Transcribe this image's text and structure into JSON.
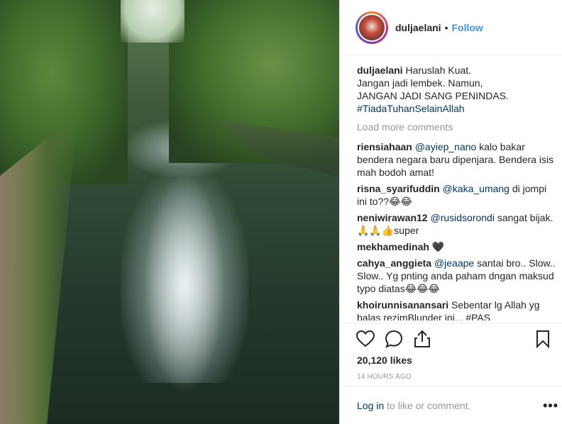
{
  "post": {
    "username": "duljaelani",
    "separator": "•",
    "follow_label": "Follow",
    "caption_lines": [
      "Haruslah Kuat.",
      "Jangan jadi lembek. Namun,",
      "JANGAN JADI SANG PENINDAS."
    ],
    "caption_hashtag": "#TiadaTuhanSelainAllah",
    "load_more_label": "Load more comments",
    "comments": [
      {
        "user": "riensiahaan",
        "mention": "@ayiep_nano",
        "text": "kalo bakar bendera negara baru dipenjara. Bendera isis mah bodoh amat!"
      },
      {
        "user": "risna_syarifuddin",
        "mention": "@kaka_umang",
        "text": "di jompi ini to??😂😂"
      },
      {
        "user": "neniwirawan12",
        "mention": "@rusidsorondi",
        "text": "sangat bijak. 🙏🙏👍super"
      },
      {
        "user": "mekhamedinah",
        "mention": "",
        "text": "🖤"
      },
      {
        "user": "cahya_anggieta",
        "mention": "@jeaape",
        "text": "santai bro.. Slow.. Slow.. Yg pnting anda paham dngan maksud typo diatas😂😂😂"
      },
      {
        "user": "khoirunnisanansari",
        "mention": "",
        "text": "Sebentar lg Allah yg balas rezimBlunder ini... #PAS"
      }
    ],
    "likes": "20,120 likes",
    "time": "14 HOURS AGO",
    "login_link": "Log in",
    "login_text": "to like or comment.",
    "more_label": "•••"
  },
  "icons": {
    "like": "heart-outline-icon",
    "comment": "speech-bubble-icon",
    "share": "share-upload-icon",
    "save": "bookmark-icon",
    "more": "more-options-icon"
  }
}
